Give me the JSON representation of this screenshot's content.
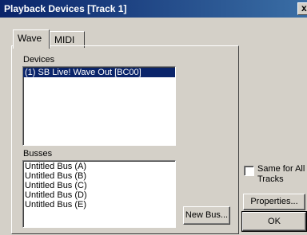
{
  "window": {
    "title": "Playback Devices [Track 1]",
    "close_label": "x"
  },
  "tabs": [
    {
      "label": "Wave",
      "active": true
    },
    {
      "label": "MIDI",
      "active": false
    }
  ],
  "devices": {
    "label": "Devices",
    "items": [
      {
        "label": "(1) SB Live! Wave Out [BC00]",
        "selected": true
      }
    ]
  },
  "busses": {
    "label": "Busses",
    "items": [
      {
        "label": "Untitled Bus (A)"
      },
      {
        "label": "Untitled Bus (B)"
      },
      {
        "label": "Untitled Bus (C)"
      },
      {
        "label": "Untitled Bus (D)"
      },
      {
        "label": "Untitled Bus (E)"
      }
    ]
  },
  "buttons": {
    "new_bus": "New Bus...",
    "properties": "Properties...",
    "ok": "OK"
  },
  "same_for_all_tracks": {
    "label_line1": "Same for All",
    "label_line2": "Tracks",
    "checked": false
  }
}
